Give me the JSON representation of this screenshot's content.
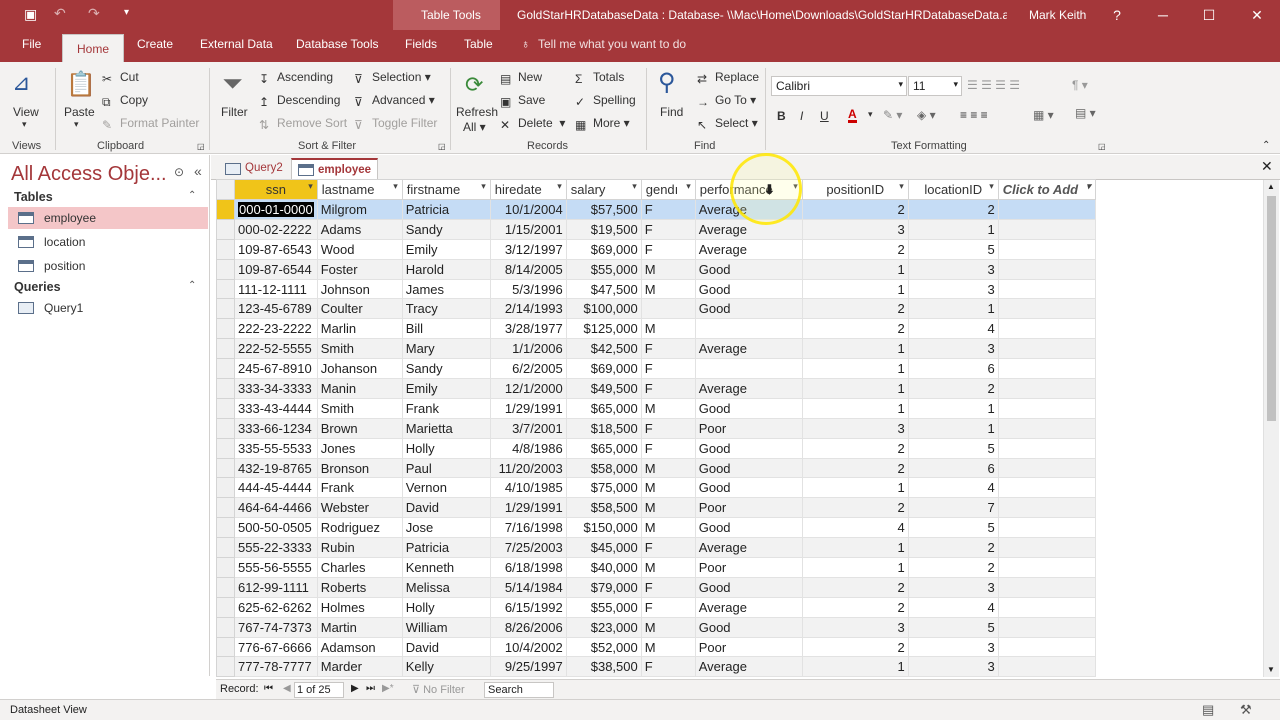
{
  "titlebar": {
    "context": "Table Tools",
    "title": "GoldStarHRDatabaseData : Database- \\\\Mac\\Home\\Downloads\\GoldStarHRDatabaseData.a...",
    "user": "Mark Keith",
    "help": "?",
    "min": "─",
    "max": "☐",
    "close": "✕"
  },
  "tabs": {
    "file": "File",
    "home": "Home",
    "create": "Create",
    "external": "External Data",
    "dbtools": "Database Tools",
    "fields": "Fields",
    "table": "Table",
    "tellme": "Tell me what you want to do"
  },
  "ribbon": {
    "views": {
      "view": "View",
      "group": "Views"
    },
    "clipboard": {
      "paste": "Paste",
      "cut": "Cut",
      "copy": "Copy",
      "format_painter": "Format Painter",
      "group": "Clipboard"
    },
    "sortfilter": {
      "filter": "Filter",
      "ascending": "Ascending",
      "descending": "Descending",
      "remove_sort": "Remove Sort",
      "selection": "Selection",
      "advanced": "Advanced",
      "toggle_filter": "Toggle Filter",
      "group": "Sort & Filter"
    },
    "records": {
      "refresh": "Refresh",
      "all": "All",
      "new": "New",
      "save": "Save",
      "delete": "Delete",
      "totals": "Totals",
      "spelling": "Spelling",
      "more": "More",
      "group": "Records"
    },
    "find": {
      "find": "Find",
      "replace": "Replace",
      "goto": "Go To",
      "select": "Select",
      "group": "Find"
    },
    "text": {
      "font": "Calibri",
      "size": "11",
      "bold": "B",
      "italic": "I",
      "underline": "U",
      "group": "Text Formatting"
    }
  },
  "nav": {
    "title": "All Access Obje...",
    "tables_label": "Tables",
    "tables": [
      "employee",
      "location",
      "position"
    ],
    "queries_label": "Queries",
    "queries": [
      "Query1"
    ]
  },
  "doctabs": [
    "Query2",
    "employee"
  ],
  "grid": {
    "headers": [
      "ssn",
      "lastname",
      "firstname",
      "hiredate",
      "salary",
      "gendı",
      "performance",
      "positionID",
      "locationID",
      "Click to Add"
    ],
    "rows": [
      [
        "000-01-0000",
        "Milgrom",
        "Patricia",
        "10/1/2004",
        "$57,500",
        "F",
        "Average",
        "2",
        "2"
      ],
      [
        "000-02-2222",
        "Adams",
        "Sandy",
        "1/15/2001",
        "$19,500",
        "F",
        "Average",
        "3",
        "1"
      ],
      [
        "109-87-6543",
        "Wood",
        "Emily",
        "3/12/1997",
        "$69,000",
        "F",
        "Average",
        "2",
        "5"
      ],
      [
        "109-87-6544",
        "Foster",
        "Harold",
        "8/14/2005",
        "$55,000",
        "M",
        "Good",
        "1",
        "3"
      ],
      [
        "111-12-1111",
        "Johnson",
        "James",
        "5/3/1996",
        "$47,500",
        "M",
        "Good",
        "1",
        "3"
      ],
      [
        "123-45-6789",
        "Coulter",
        "Tracy",
        "2/14/1993",
        "$100,000",
        "",
        "Good",
        "2",
        "1"
      ],
      [
        "222-23-2222",
        "Marlin",
        "Bill",
        "3/28/1977",
        "$125,000",
        "M",
        "",
        "2",
        "4"
      ],
      [
        "222-52-5555",
        "Smith",
        "Mary",
        "1/1/2006",
        "$42,500",
        "F",
        "Average",
        "1",
        "3"
      ],
      [
        "245-67-8910",
        "Johanson",
        "Sandy",
        "6/2/2005",
        "$69,000",
        "F",
        "",
        "1",
        "6"
      ],
      [
        "333-34-3333",
        "Manin",
        "Emily",
        "12/1/2000",
        "$49,500",
        "F",
        "Average",
        "1",
        "2"
      ],
      [
        "333-43-4444",
        "Smith",
        "Frank",
        "1/29/1991",
        "$65,000",
        "M",
        "Good",
        "1",
        "1"
      ],
      [
        "333-66-1234",
        "Brown",
        "Marietta",
        "3/7/2001",
        "$18,500",
        "F",
        "Poor",
        "3",
        "1"
      ],
      [
        "335-55-5533",
        "Jones",
        "Holly",
        "4/8/1986",
        "$65,000",
        "F",
        "Good",
        "2",
        "5"
      ],
      [
        "432-19-8765",
        "Bronson",
        "Paul",
        "11/20/2003",
        "$58,000",
        "M",
        "Good",
        "2",
        "6"
      ],
      [
        "444-45-4444",
        "Frank",
        "Vernon",
        "4/10/1985",
        "$75,000",
        "M",
        "Good",
        "1",
        "4"
      ],
      [
        "464-64-4466",
        "Webster",
        "David",
        "1/29/1991",
        "$58,500",
        "M",
        "Poor",
        "2",
        "7"
      ],
      [
        "500-50-0505",
        "Rodriguez",
        "Jose",
        "7/16/1998",
        "$150,000",
        "M",
        "Good",
        "4",
        "5"
      ],
      [
        "555-22-3333",
        "Rubin",
        "Patricia",
        "7/25/2003",
        "$45,000",
        "F",
        "Average",
        "1",
        "2"
      ],
      [
        "555-56-5555",
        "Charles",
        "Kenneth",
        "6/18/1998",
        "$40,000",
        "M",
        "Poor",
        "1",
        "2"
      ],
      [
        "612-99-1111",
        "Roberts",
        "Melissa",
        "5/14/1984",
        "$79,000",
        "F",
        "Good",
        "2",
        "3"
      ],
      [
        "625-62-6262",
        "Holmes",
        "Holly",
        "6/15/1992",
        "$55,000",
        "F",
        "Average",
        "2",
        "4"
      ],
      [
        "767-74-7373",
        "Martin",
        "William",
        "8/26/2006",
        "$23,000",
        "M",
        "Good",
        "3",
        "5"
      ],
      [
        "776-67-6666",
        "Adamson",
        "David",
        "10/4/2002",
        "$52,000",
        "M",
        "Poor",
        "2",
        "3"
      ],
      [
        "777-78-7777",
        "Marder",
        "Kelly",
        "9/25/1997",
        "$38,500",
        "F",
        "Average",
        "1",
        "3"
      ]
    ]
  },
  "recnav": {
    "label": "Record:",
    "position": "1 of 25",
    "nofilter": "No Filter",
    "search": "Search"
  },
  "status": {
    "text": "Datasheet View"
  }
}
